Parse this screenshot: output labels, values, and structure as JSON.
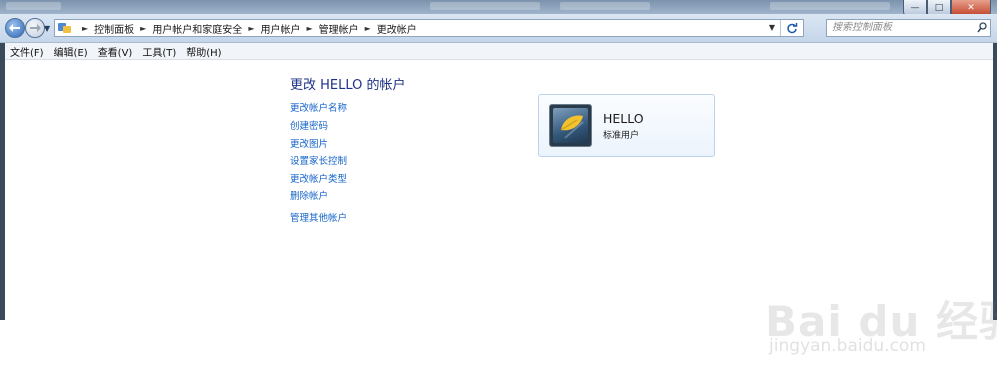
{
  "window": {
    "minimize_glyph": "—",
    "maximize_glyph": "□",
    "close_glyph": "✕"
  },
  "address_bar": {
    "breadcrumbs": [
      "控制面板",
      "用户帐户和家庭安全",
      "用户帐户",
      "管理帐户",
      "更改帐户"
    ],
    "search_placeholder": "搜索控制面板"
  },
  "menu": {
    "items": [
      "文件(F)",
      "编辑(E)",
      "查看(V)",
      "工具(T)",
      "帮助(H)"
    ]
  },
  "main": {
    "title": "更改 HELLO 的帐户",
    "tasks": [
      "更改帐户名称",
      "创建密码",
      "更改图片",
      "设置家长控制",
      "更改帐户类型",
      "删除帐户"
    ],
    "other_link": "管理其他帐户"
  },
  "account": {
    "name": "HELLO",
    "type": "标准用户"
  },
  "watermark": {
    "main": "Bai du 经验",
    "sub": "jingyan.baidu.com"
  },
  "icons": {
    "back": "back-arrow-icon",
    "forward": "forward-arrow-icon",
    "control_panel": "control-panel-icon",
    "refresh": "refresh-icon",
    "search": "search-icon"
  },
  "colors": {
    "title": "#1e3287",
    "link": "#1664c9"
  }
}
